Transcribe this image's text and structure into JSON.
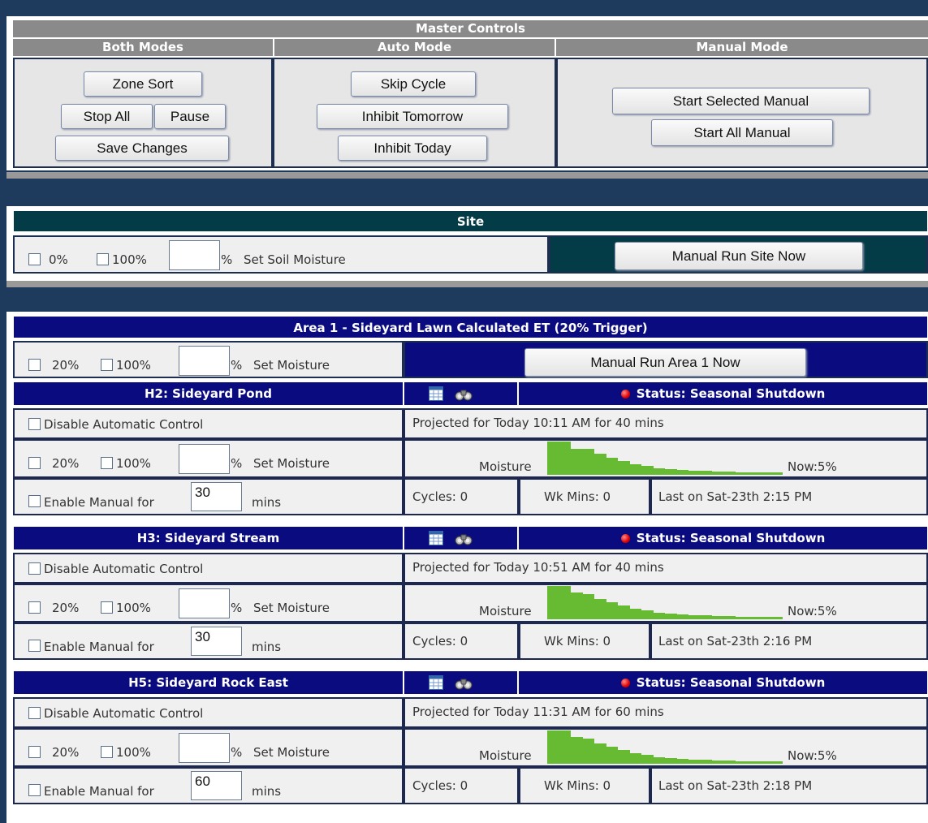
{
  "master": {
    "title": "Master Controls",
    "col_both": "Both Modes",
    "col_auto": "Auto Mode",
    "col_manual": "Manual Mode",
    "zone_sort": "Zone Sort",
    "stop_all": "Stop All",
    "pause": "Pause",
    "save_changes": "Save Changes",
    "skip_cycle": "Skip Cycle",
    "inhibit_tomorrow": "Inhibit Tomorrow",
    "inhibit_today": "Inhibit Today",
    "start_selected_manual": "Start Selected Manual",
    "start_all_manual": "Start All Manual"
  },
  "site": {
    "title": "Site",
    "opt_low": "0%",
    "opt_high": "100%",
    "percent_value": "",
    "percent_sign": "%",
    "set_label": "Set Soil Moisture",
    "run_button": "Manual Run Site Now"
  },
  "area": {
    "title": "Area 1 - Sideyard Lawn  Calculated ET (20% Trigger)",
    "opt_low": "20%",
    "opt_high": "100%",
    "percent_value": "",
    "percent_sign": "%",
    "set_label": "Set Moisture",
    "run_button": "Manual Run Area 1 Now"
  },
  "zones": [
    {
      "name": "H2:  Sideyard Pond",
      "status": "Status: Seasonal Shutdown",
      "disable_label": "Disable Automatic Control",
      "projected": "Projected for Today  10:11 AM for 40 mins",
      "opt_low": "20%",
      "opt_high": "100%",
      "percent_value": "",
      "percent_sign": "%",
      "set_label": "Set Moisture",
      "moisture_label": "Moisture",
      "now_label": "Now:5%",
      "enable_label": "Enable Manual for",
      "manual_mins": "30",
      "mins_label": "mins",
      "cycles": "Cycles: 0",
      "wk_mins": "Wk Mins: 0",
      "last_on": "Last on Sat-23th 2:15 PM",
      "moisture_history": [
        1.0,
        1.0,
        0.78,
        0.78,
        0.62,
        0.5,
        0.4,
        0.3,
        0.24,
        0.18,
        0.14,
        0.12,
        0.1,
        0.09,
        0.08,
        0.07,
        0.06,
        0.06,
        0.05,
        0.05
      ]
    },
    {
      "name": "H3:  Sideyard Stream",
      "status": "Status: Seasonal Shutdown",
      "disable_label": "Disable Automatic Control",
      "projected": "Projected for Today  10:51 AM for 40 mins",
      "opt_low": "20%",
      "opt_high": "100%",
      "percent_value": "",
      "percent_sign": "%",
      "set_label": "Set Moisture",
      "moisture_label": "Moisture",
      "now_label": "Now:5%",
      "enable_label": "Enable Manual for",
      "manual_mins": "30",
      "mins_label": "mins",
      "cycles": "Cycles: 0",
      "wk_mins": "Wk Mins: 0",
      "last_on": "Last on Sat-23th 2:16 PM",
      "moisture_history": [
        1.0,
        1.0,
        0.8,
        0.75,
        0.6,
        0.5,
        0.4,
        0.3,
        0.24,
        0.18,
        0.14,
        0.12,
        0.1,
        0.09,
        0.08,
        0.07,
        0.06,
        0.06,
        0.05,
        0.05
      ]
    },
    {
      "name": "H5:  Sideyard Rock East",
      "status": "Status: Seasonal Shutdown",
      "disable_label": "Disable Automatic Control",
      "projected": "Projected for Today  11:31 AM for 60 mins",
      "opt_low": "20%",
      "opt_high": "100%",
      "percent_value": "",
      "percent_sign": "%",
      "set_label": "Set Moisture",
      "moisture_label": "Moisture",
      "now_label": "Now:5%",
      "enable_label": "Enable Manual for",
      "manual_mins": "60",
      "mins_label": "mins",
      "cycles": "Cycles: 0",
      "wk_mins": "Wk Mins: 0",
      "last_on": "Last on Sat-23th 2:18 PM",
      "moisture_history": [
        1.0,
        1.0,
        0.8,
        0.75,
        0.6,
        0.5,
        0.4,
        0.3,
        0.24,
        0.18,
        0.14,
        0.12,
        0.1,
        0.09,
        0.08,
        0.07,
        0.06,
        0.06,
        0.05,
        0.05
      ]
    }
  ],
  "colors": {
    "background": "#1e3a5c",
    "navy_header": "#0b0b80",
    "teal_header": "#033c46",
    "moisture_bar": "#66bb33",
    "status_dot": "#e00000"
  },
  "icons": [
    "calendar-icon",
    "binoculars-icon",
    "status-dot-icon"
  ]
}
